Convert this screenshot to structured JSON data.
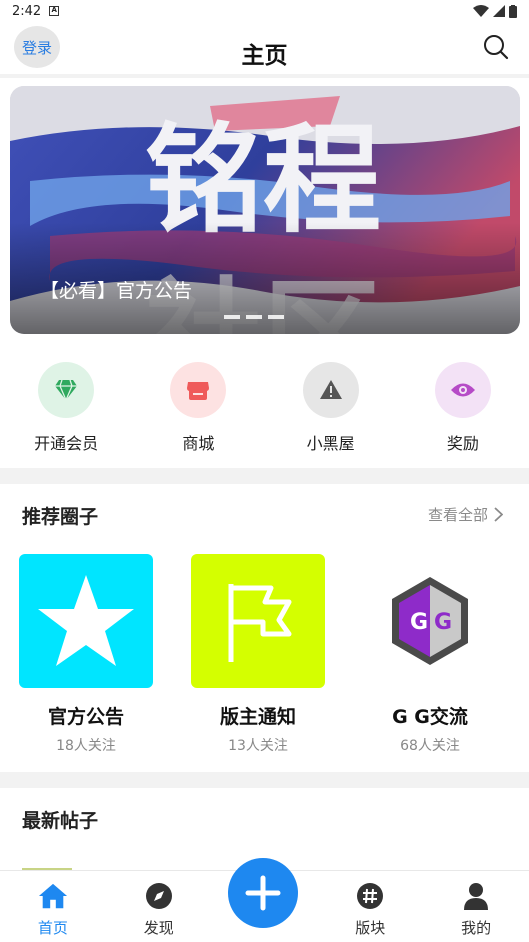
{
  "status_bar": {
    "time": "2:42",
    "a_label": "A"
  },
  "header": {
    "login_label": "登录",
    "title": "主页"
  },
  "banner": {
    "caption": "【必看】官方公告",
    "art_text_top": "铭程",
    "art_text_bottom": "社区"
  },
  "quick_entries": [
    {
      "label": "开通会员",
      "icon": "diamond-icon",
      "bg": "#dff3e6",
      "fg": "#2fa95e"
    },
    {
      "label": "商城",
      "icon": "store-icon",
      "bg": "#fde2e2",
      "fg": "#ef5a5a"
    },
    {
      "label": "小黑屋",
      "icon": "warning-icon",
      "bg": "#e6e6e6",
      "fg": "#555555"
    },
    {
      "label": "奖励",
      "icon": "eye-icon",
      "bg": "#f3e2f6",
      "fg": "#b64bc7"
    }
  ],
  "recommend": {
    "title": "推荐圈子",
    "see_all": "查看全部",
    "circles": [
      {
        "name": "官方公告",
        "followers": "18人关注",
        "icon": "star-icon",
        "bg": "#00e5ff"
      },
      {
        "name": "版主通知",
        "followers": "13人关注",
        "icon": "flag-icon",
        "bg": "#d4ff00"
      },
      {
        "name": "G G交流",
        "followers": "68人关注",
        "icon": "gg-logo-icon",
        "bg": "#ffffff"
      }
    ]
  },
  "latest": {
    "title": "最新帖子"
  },
  "bottom_nav": [
    {
      "label": "首页",
      "icon": "home-icon",
      "active": true
    },
    {
      "label": "发现",
      "icon": "compass-icon",
      "active": false
    },
    {
      "label": "版块",
      "icon": "hash-icon",
      "active": false
    },
    {
      "label": "我的",
      "icon": "person-icon",
      "active": false
    }
  ],
  "colors": {
    "accent": "#1e88f0"
  }
}
